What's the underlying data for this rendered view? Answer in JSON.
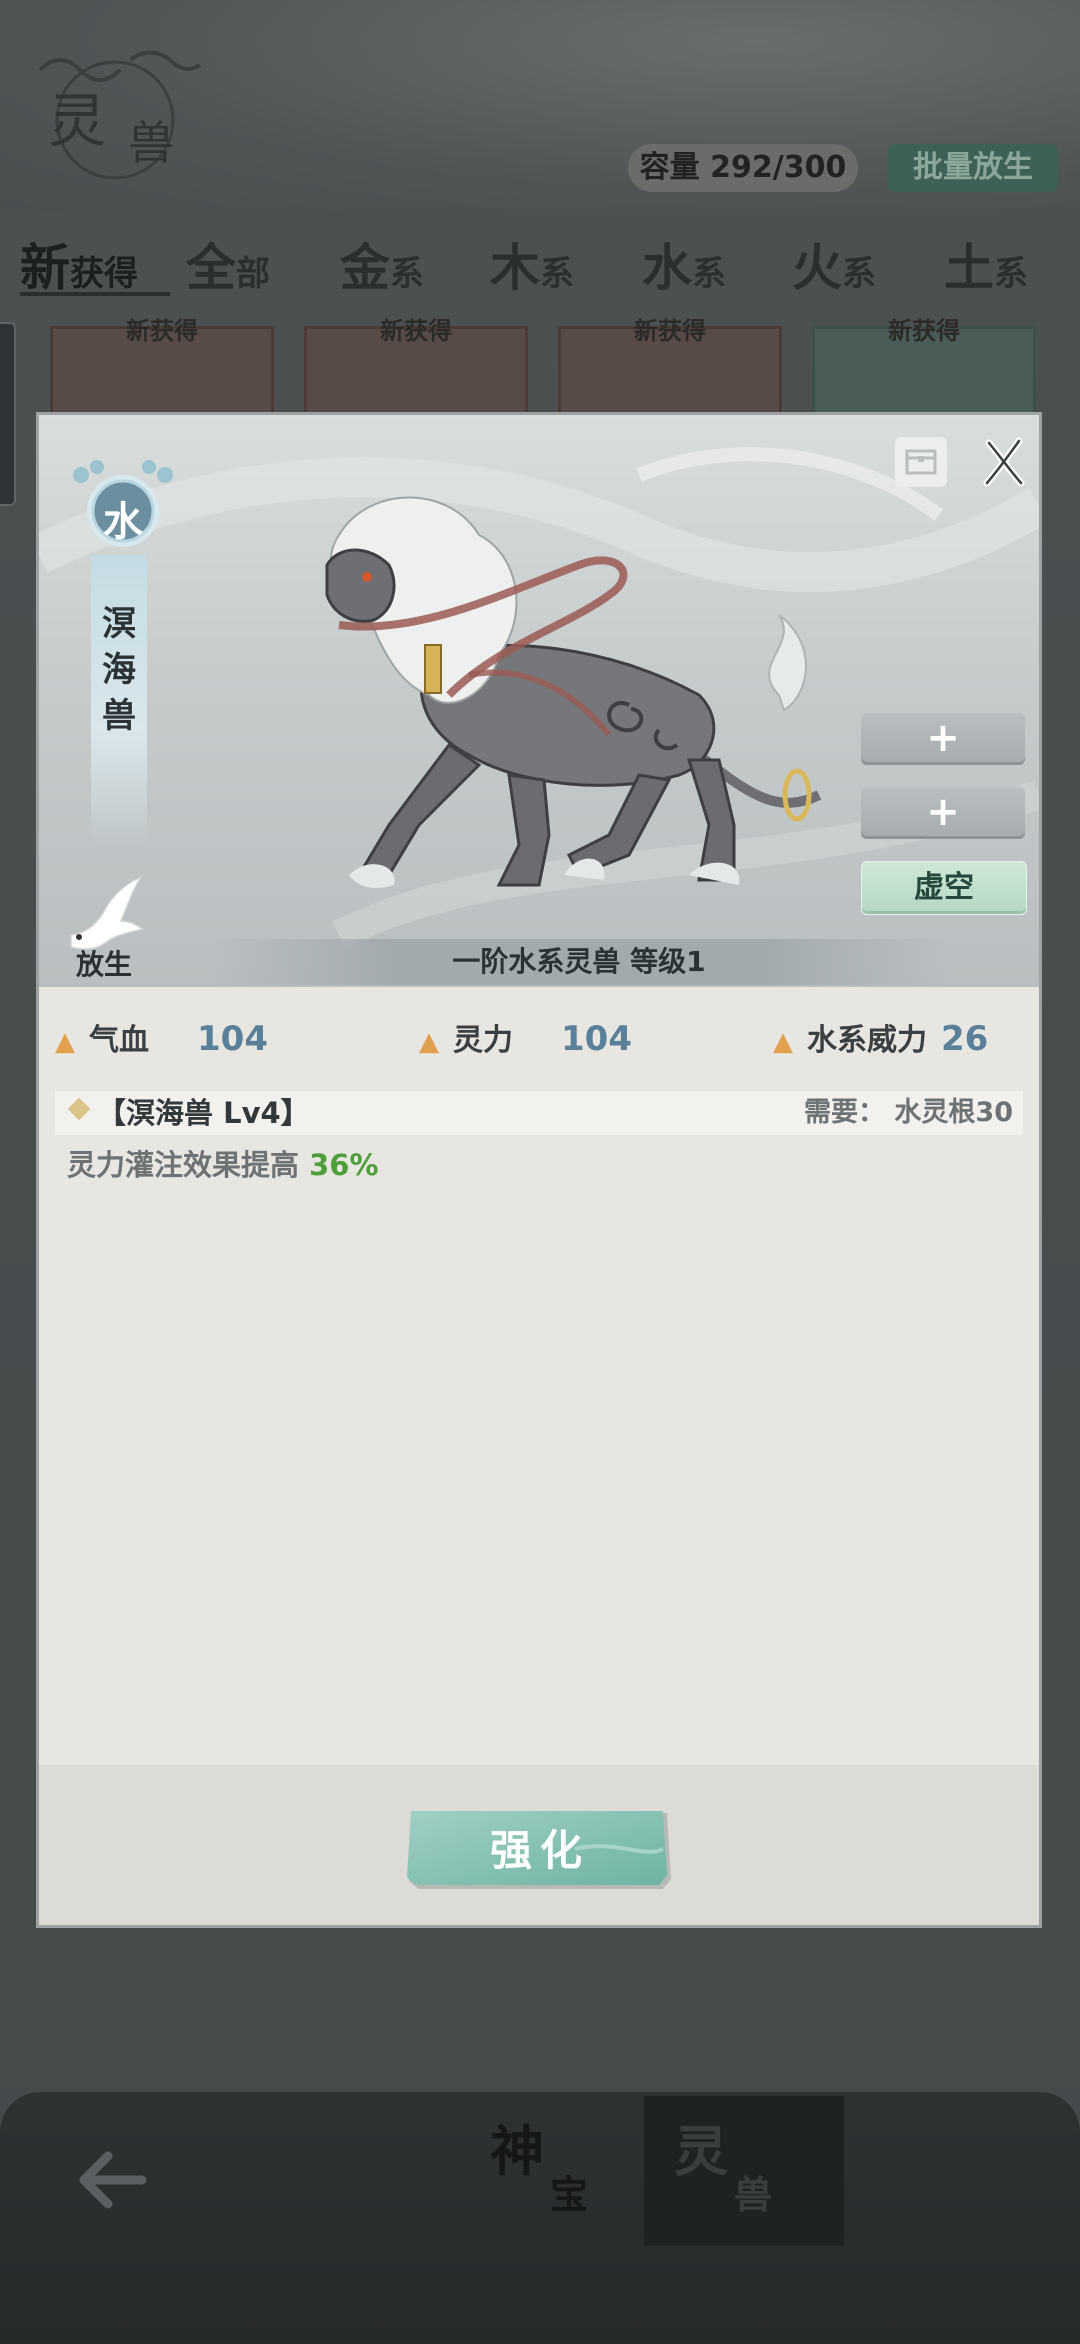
{
  "background": {
    "logo_line1": "灵",
    "logo_line2": "兽",
    "capacity_label": "容量 292/300",
    "batch_release_label": "批量放生",
    "tabs": [
      {
        "big": "新",
        "small": "获得"
      },
      {
        "big": "全",
        "small": "部"
      },
      {
        "big": "金",
        "small": "系"
      },
      {
        "big": "木",
        "small": "系"
      },
      {
        "big": "水",
        "small": "系"
      },
      {
        "big": "火",
        "small": "系"
      },
      {
        "big": "土",
        "small": "系"
      }
    ],
    "card_new_label": "新获得"
  },
  "bottom_nav": {
    "items": [
      {
        "a": "神",
        "b": "宝"
      },
      {
        "a": "灵",
        "b": "兽"
      }
    ],
    "back_icon": "back-arrow-icon"
  },
  "modal": {
    "element_char": "水",
    "beast_name": "溟海兽",
    "release_label": "放生",
    "slots": [
      "+",
      "+"
    ],
    "void_slot_label": "虚空",
    "rank_text": "一阶水系灵兽   等级1",
    "stats": [
      {
        "label": "气血",
        "value": "104"
      },
      {
        "label": "灵力",
        "value": "104"
      },
      {
        "label": "水系威力",
        "value": "26"
      }
    ],
    "skill": {
      "name": "【溟海兽 Lv4】",
      "requirement": "需要：  水灵根30",
      "desc_prefix": "灵力灌注效果提高 ",
      "desc_pct": "36%"
    },
    "enhance_label": "强化",
    "colors": {
      "accent_teal": "#7fbfb2",
      "stat_value": "#5a7f99",
      "stat_triangle": "#e0a050",
      "pct_green": "#4f9e3c"
    }
  }
}
